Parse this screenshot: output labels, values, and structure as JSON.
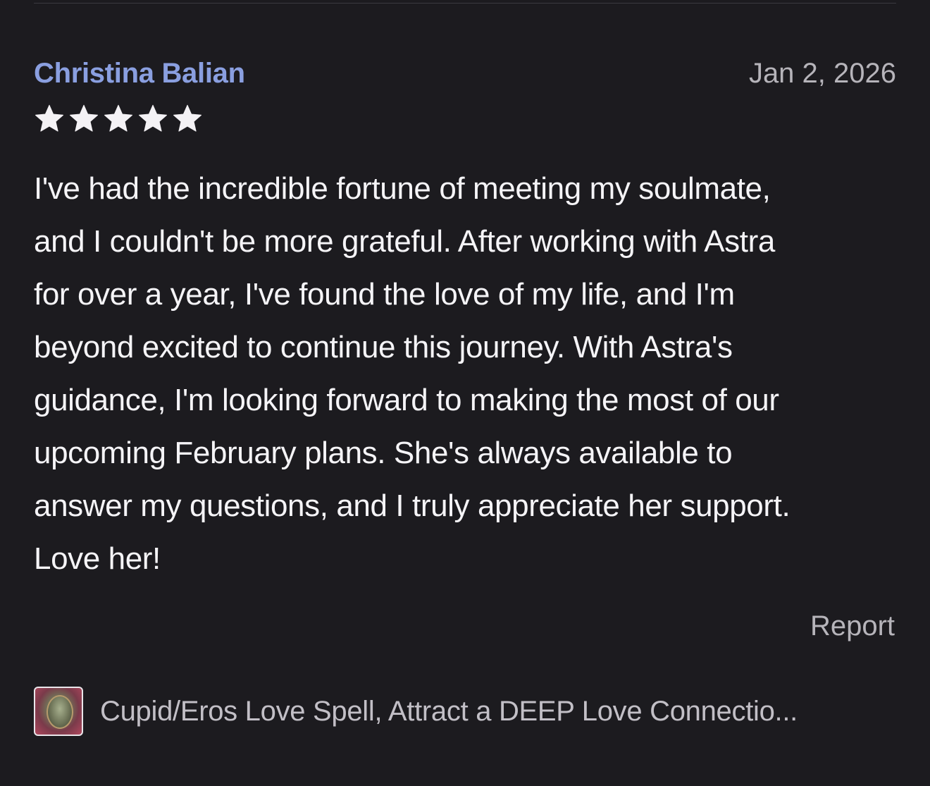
{
  "review": {
    "reviewer_name": "Christina Balian",
    "date": "Jan 2, 2026",
    "rating": 5,
    "rating_max": 5,
    "text": "I've had the incredible fortune of meeting my soulmate,\nand I couldn't be more grateful. After working with Astra\nfor over a year, I've found the love of my life, and I'm\nbeyond excited to continue this journey. With Astra's\nguidance, I'm looking forward to making the most of our\nupcoming February plans. She's always available to\nanswer my questions, and I truly appreciate her support.\nLove her!",
    "report_label": "Report"
  },
  "product": {
    "title": "Cupid/Eros Love Spell,  Attract a DEEP Love Connectio...",
    "thumbnail_icon": "ring-product-thumbnail"
  },
  "colors": {
    "background": "#1c1b1f",
    "reviewer_name": "#8a9fe0",
    "star": "#f4f2f5",
    "secondary_text": "#b6b4ba",
    "primary_text": "#f5f4f7"
  }
}
